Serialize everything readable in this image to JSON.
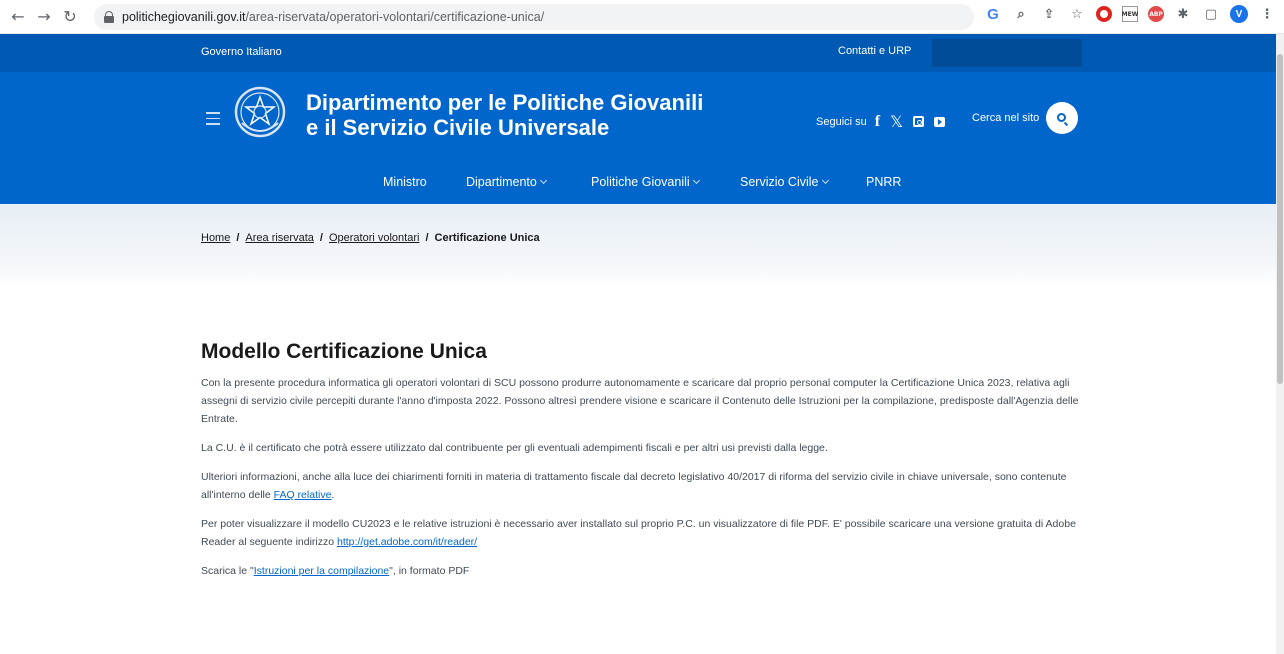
{
  "browser": {
    "url_domain": "politichegiovanili.gov.it",
    "url_path": "/area-riservata/operatori-volontari/certificazione-unica/",
    "profile_initial": "V",
    "extension_abp": "ABP",
    "extension_mew": "MEW"
  },
  "slim_header": {
    "government": "Governo Italiano",
    "contacts": "Contatti e URP"
  },
  "header": {
    "title_line1": "Dipartimento per le Politiche Giovanili",
    "title_line2": "e il Servizio Civile Universale",
    "follow_label": "Seguici su",
    "search_label": "Cerca nel sito"
  },
  "nav": {
    "items": [
      "Ministro",
      "Dipartimento",
      "Politiche Giovanili",
      "Servizio Civile",
      "PNRR"
    ]
  },
  "breadcrumb": {
    "home": "Home",
    "reserved": "Area riservata",
    "volunteers": "Operatori volontari",
    "current": "Certificazione Unica",
    "separator": "/"
  },
  "content": {
    "title": "Modello Certificazione Unica",
    "p1": "Con la presente procedura informatica gli operatori volontari di SCU possono produrre autonomamente e scaricare dal proprio personal computer la Certificazione Unica 2023, relativa agli assegni di servizio civile percepiti durante l'anno d'imposta 2022. Possono altresì prendere visione e scaricare il Contenuto delle Istruzioni per la compilazione, predisposte dall'Agenzia delle Entrate.",
    "p2": "La C.U. è il certificato che potrà essere utilizzato dal contribuente per gli eventuali adempimenti fiscali  e per altri usi previsti dalla legge.",
    "p3_text": "Ulteriori informazioni, anche alla luce dei chiarimenti forniti in materia di trattamento fiscale dal decreto legislativo 40/2017 di riforma del servizio civile in chiave universale, sono contenute all'interno delle ",
    "p3_link": "FAQ relative",
    "p3_end": ".",
    "p4_text": "Per poter visualizzare il modello CU2023 e le relative istruzioni è necessario aver installato sul proprio P.C. un visualizzatore di file PDF. E' possibile scaricare una versione gratuita di Adobe Reader al seguente indirizzo ",
    "p4_link": "http://get.adobe.com/it/reader/",
    "p5_text": "Scarica le \"",
    "p5_link": "Istruzioni per la compilazione",
    "p5_end": "\", in formato PDF"
  },
  "colors": {
    "slim_header": "#0059b3",
    "header": "#0066cc",
    "link": "#0066cc"
  }
}
